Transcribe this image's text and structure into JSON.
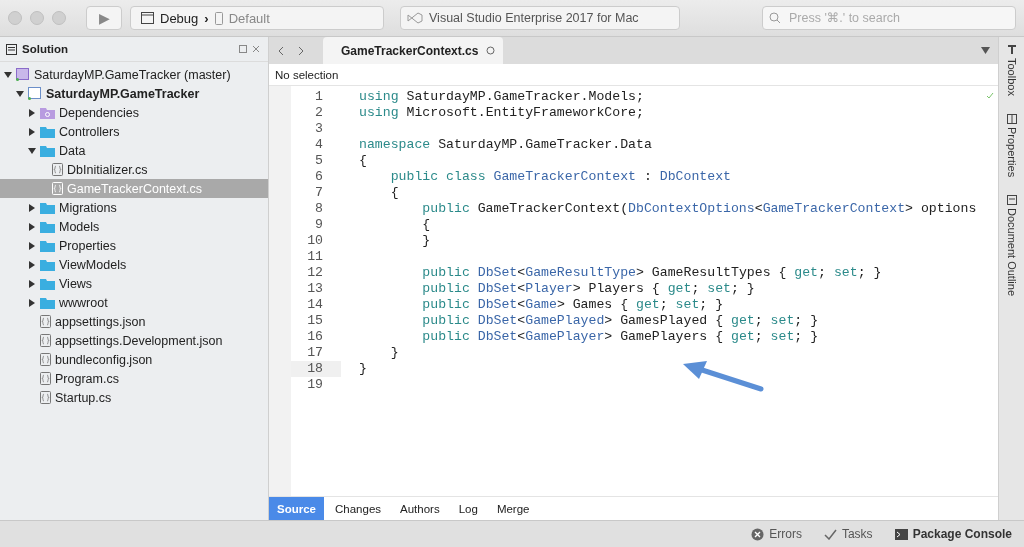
{
  "toolbar": {
    "run_button": "▶",
    "configuration": "Debug",
    "separator": "›",
    "device": "Default",
    "title": "Visual Studio Enterprise 2017 for Mac",
    "search": {
      "placeholder": "Press '⌘.' to search"
    }
  },
  "solution_pad": {
    "title": "Solution",
    "tree": [
      {
        "label": "SaturdayMP.GameTracker (master)",
        "kind": "solution",
        "expanded": true,
        "selected": false,
        "children": [
          {
            "label": "SaturdayMP.GameTracker",
            "kind": "project",
            "expanded": true,
            "selected": false,
            "children": [
              {
                "label": "Dependencies",
                "kind": "dependencies",
                "expanded": false,
                "selected": false
              },
              {
                "label": "Controllers",
                "kind": "folder",
                "expanded": false,
                "selected": false
              },
              {
                "label": "Data",
                "kind": "folder",
                "expanded": true,
                "selected": false,
                "children": [
                  {
                    "label": "DbInitializer.cs",
                    "kind": "file",
                    "selected": false
                  },
                  {
                    "label": "GameTrackerContext.cs",
                    "kind": "file",
                    "selected": true
                  }
                ]
              },
              {
                "label": "Migrations",
                "kind": "folder",
                "expanded": false,
                "selected": false
              },
              {
                "label": "Models",
                "kind": "folder",
                "expanded": false,
                "selected": false
              },
              {
                "label": "Properties",
                "kind": "folder",
                "expanded": false,
                "selected": false
              },
              {
                "label": "ViewModels",
                "kind": "folder",
                "expanded": false,
                "selected": false
              },
              {
                "label": "Views",
                "kind": "folder",
                "expanded": false,
                "selected": false
              },
              {
                "label": "wwwroot",
                "kind": "folder",
                "expanded": false,
                "selected": false
              },
              {
                "label": "appsettings.json",
                "kind": "file",
                "selected": false
              },
              {
                "label": "appsettings.Development.json",
                "kind": "file",
                "selected": false
              },
              {
                "label": "bundleconfig.json",
                "kind": "file",
                "selected": false
              },
              {
                "label": "Program.cs",
                "kind": "file",
                "selected": false
              },
              {
                "label": "Startup.cs",
                "kind": "file",
                "selected": false
              }
            ]
          }
        ]
      }
    ]
  },
  "editor": {
    "tabs": [
      {
        "label": "GameTrackerContext.cs",
        "selected": true
      }
    ],
    "breadcrumb": "No selection",
    "lines": [
      {
        "number": "1",
        "current": false,
        "tokens": [
          {
            "text": "using",
            "kind": "keyword"
          },
          {
            "text": " SaturdayMP.GameTracker.Models;",
            "kind": "plain"
          }
        ]
      },
      {
        "number": "2",
        "current": false,
        "tokens": [
          {
            "text": "using",
            "kind": "keyword"
          },
          {
            "text": " Microsoft.EntityFrameworkCore;",
            "kind": "plain"
          }
        ]
      },
      {
        "number": "3",
        "current": false
      },
      {
        "number": "4",
        "current": false,
        "tokens": [
          {
            "text": "namespace",
            "kind": "keyword"
          },
          {
            "text": " SaturdayMP.GameTracker.Data",
            "kind": "plain"
          }
        ]
      },
      {
        "number": "5",
        "current": false,
        "tokens": [
          {
            "text": "{",
            "kind": "plain"
          }
        ]
      },
      {
        "number": "6",
        "current": false,
        "tokens": [
          {
            "text": "    public class ",
            "kind": "keyword"
          },
          {
            "text": "GameTrackerContext",
            "kind": "type"
          },
          {
            "text": " : ",
            "kind": "plain"
          },
          {
            "text": "DbContext",
            "kind": "type"
          }
        ]
      },
      {
        "number": "7",
        "current": false,
        "tokens": [
          {
            "text": "    {",
            "kind": "plain"
          }
        ]
      },
      {
        "number": "8",
        "current": false,
        "tokens": [
          {
            "text": "        public",
            "kind": "keyword"
          },
          {
            "text": " GameTrackerContext(",
            "kind": "plain"
          },
          {
            "text": "DbContextOptions",
            "kind": "type"
          },
          {
            "text": "<",
            "kind": "plain"
          },
          {
            "text": "GameTrackerContext",
            "kind": "type"
          },
          {
            "text": "> options",
            "kind": "plain"
          }
        ]
      },
      {
        "number": "9",
        "current": false,
        "tokens": [
          {
            "text": "        {",
            "kind": "plain"
          }
        ]
      },
      {
        "number": "10",
        "current": false,
        "tokens": [
          {
            "text": "        }",
            "kind": "plain"
          }
        ]
      },
      {
        "number": "11",
        "current": false
      },
      {
        "number": "12",
        "current": false,
        "tokens": [
          {
            "text": "        public ",
            "kind": "keyword"
          },
          {
            "text": "DbSet",
            "kind": "type"
          },
          {
            "text": "<",
            "kind": "plain"
          },
          {
            "text": "GameResultType",
            "kind": "type"
          },
          {
            "text": "> GameResultTypes { ",
            "kind": "plain"
          },
          {
            "text": "get",
            "kind": "keyword"
          },
          {
            "text": "; ",
            "kind": "plain"
          },
          {
            "text": "set",
            "kind": "keyword"
          },
          {
            "text": "; }",
            "kind": "plain"
          }
        ]
      },
      {
        "number": "13",
        "current": false,
        "tokens": [
          {
            "text": "        public ",
            "kind": "keyword"
          },
          {
            "text": "DbSet",
            "kind": "type"
          },
          {
            "text": "<",
            "kind": "plain"
          },
          {
            "text": "Player",
            "kind": "type"
          },
          {
            "text": "> Players { ",
            "kind": "plain"
          },
          {
            "text": "get",
            "kind": "keyword"
          },
          {
            "text": "; ",
            "kind": "plain"
          },
          {
            "text": "set",
            "kind": "keyword"
          },
          {
            "text": "; }",
            "kind": "plain"
          }
        ]
      },
      {
        "number": "14",
        "current": false,
        "tokens": [
          {
            "text": "        public ",
            "kind": "keyword"
          },
          {
            "text": "DbSet",
            "kind": "type"
          },
          {
            "text": "<",
            "kind": "plain"
          },
          {
            "text": "Game",
            "kind": "type"
          },
          {
            "text": "> Games { ",
            "kind": "plain"
          },
          {
            "text": "get",
            "kind": "keyword"
          },
          {
            "text": "; ",
            "kind": "plain"
          },
          {
            "text": "set",
            "kind": "keyword"
          },
          {
            "text": "; }",
            "kind": "plain"
          }
        ]
      },
      {
        "number": "15",
        "current": false,
        "tokens": [
          {
            "text": "        public ",
            "kind": "keyword"
          },
          {
            "text": "DbSet",
            "kind": "type"
          },
          {
            "text": "<",
            "kind": "plain"
          },
          {
            "text": "GamePlayed",
            "kind": "type"
          },
          {
            "text": "> GamesPlayed { ",
            "kind": "plain"
          },
          {
            "text": "get",
            "kind": "keyword"
          },
          {
            "text": "; ",
            "kind": "plain"
          },
          {
            "text": "set",
            "kind": "keyword"
          },
          {
            "text": "; }",
            "kind": "plain"
          }
        ]
      },
      {
        "number": "16",
        "current": false,
        "tokens": [
          {
            "text": "        public ",
            "kind": "keyword"
          },
          {
            "text": "DbSet",
            "kind": "type"
          },
          {
            "text": "<",
            "kind": "plain"
          },
          {
            "text": "GamePlayer",
            "kind": "type"
          },
          {
            "text": "> GamePlayers { ",
            "kind": "plain"
          },
          {
            "text": "get",
            "kind": "keyword"
          },
          {
            "text": "; ",
            "kind": "plain"
          },
          {
            "text": "set",
            "kind": "keyword"
          },
          {
            "text": "; }",
            "kind": "plain"
          }
        ]
      },
      {
        "number": "17",
        "current": false,
        "tokens": [
          {
            "text": "    }",
            "kind": "plain"
          }
        ]
      },
      {
        "number": "18",
        "current": true,
        "tokens": [
          {
            "text": "}",
            "kind": "plain"
          }
        ]
      },
      {
        "number": "19",
        "current": false
      }
    ],
    "bottom_tabs": [
      {
        "label": "Source",
        "selected": true
      },
      {
        "label": "Changes",
        "selected": false
      },
      {
        "label": "Authors",
        "selected": false
      },
      {
        "label": "Log",
        "selected": false
      },
      {
        "label": "Merge",
        "selected": false
      }
    ]
  },
  "right_pads": [
    {
      "label": "Toolbox",
      "kind": "toolbox"
    },
    {
      "label": "Properties",
      "kind": "properties"
    },
    {
      "label": "Document Outline",
      "kind": "outline"
    }
  ],
  "status_bar": [
    {
      "label": "Errors",
      "kind": "errors"
    },
    {
      "label": "Tasks",
      "kind": "tasks"
    },
    {
      "label": "Package Console",
      "kind": "console"
    }
  ]
}
